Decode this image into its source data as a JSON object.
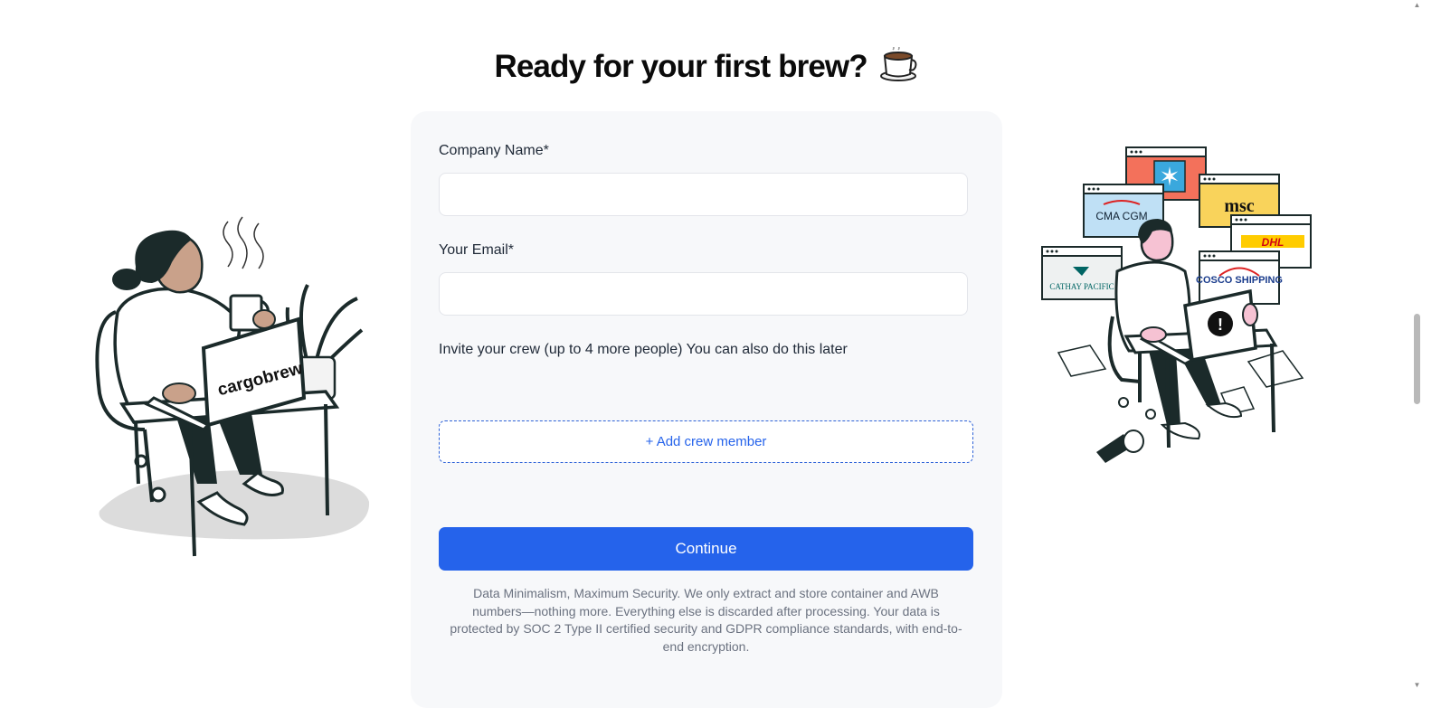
{
  "page": {
    "heading": "Ready for your first brew?",
    "heading_icon": "coffee-cup-icon"
  },
  "form": {
    "company_label": "Company Name*",
    "company_value": "",
    "email_label": "Your Email*",
    "email_value": "",
    "invite_text": "Invite your crew (up to 4 more people) You can also do this later",
    "add_crew_label": "+ Add crew member",
    "continue_label": "Continue",
    "disclaimer": "Data Minimalism, Maximum Security. We only extract and store container and AWB numbers—nothing more. Everything else is discarded after processing. Your data is protected by SOC 2 Type II certified security and GDPR compliance standards, with end-to-end encryption."
  },
  "illustrations": {
    "left": {
      "laptop_brand": "cargobrew"
    },
    "right": {
      "carrier_logos": [
        "CMA CGM",
        "msc",
        "DHL",
        "CATHAY PACIFIC",
        "COSCO SHIPPING"
      ],
      "alert_icon": "exclamation-icon"
    }
  },
  "colors": {
    "accent": "#2563eb",
    "card_bg": "#f7f8fa"
  }
}
